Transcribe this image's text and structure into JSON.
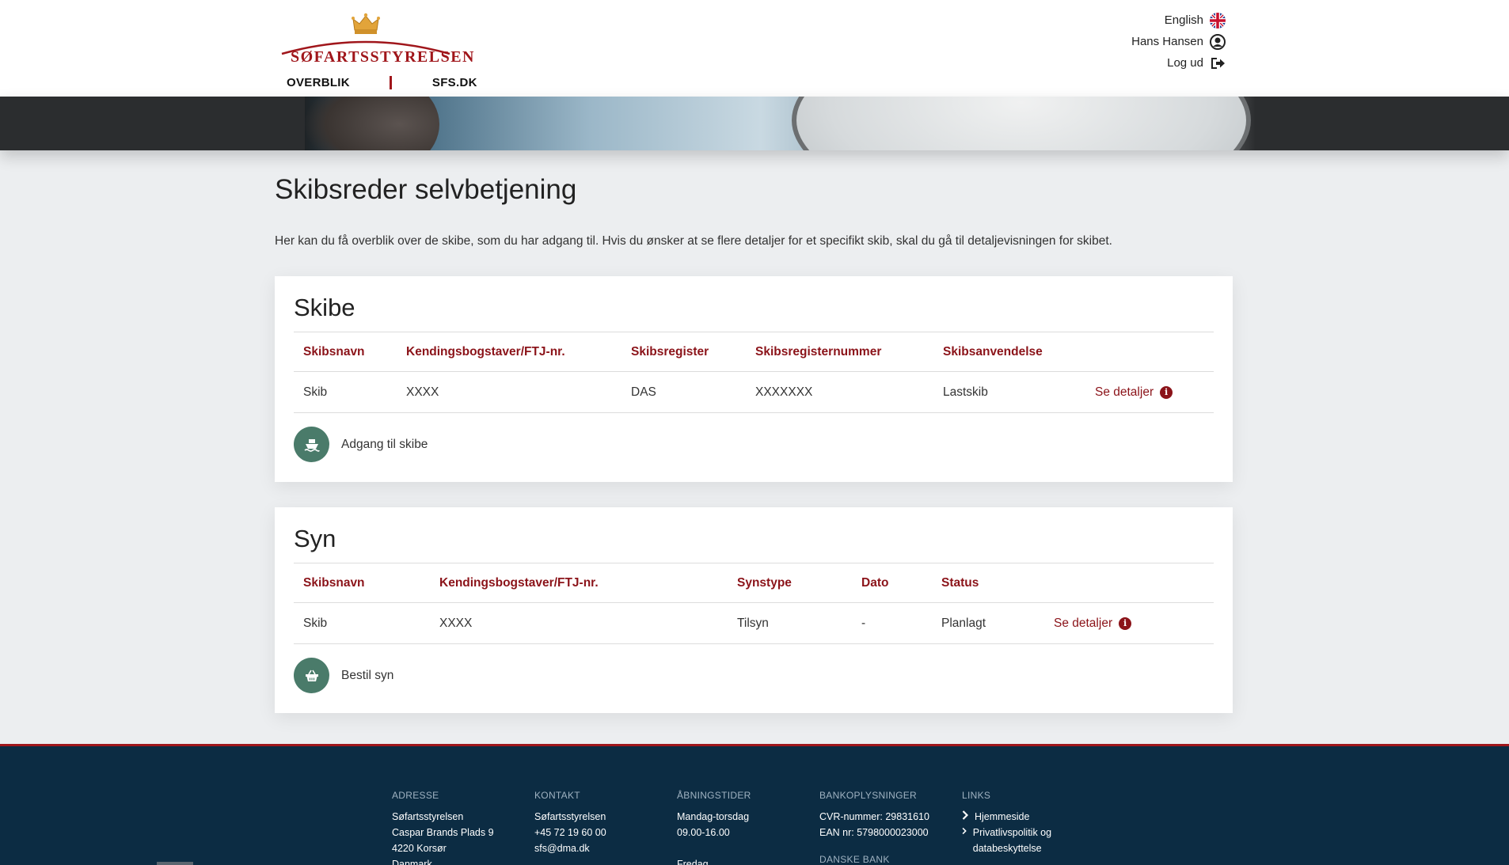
{
  "header": {
    "logo_text": "SØFARTSSTYRELSEN",
    "nav": {
      "overblik": "OVERBLIK",
      "sfs": "SFS.DK"
    },
    "user_menu": {
      "language": "English",
      "user_name": "Hans Hansen",
      "logout": "Log ud"
    }
  },
  "page": {
    "title": "Skibsreder selvbetjening",
    "intro": "Her kan du få overblik over de skibe, som du har adgang til. Hvis du ønsker at se flere detaljer for et specifikt skib, skal du gå til detaljevisningen for skibet."
  },
  "ships": {
    "title": "Skibe",
    "columns": [
      "Skibsnavn",
      "Kendingsbogstaver/FTJ-nr.",
      "Skibsregister",
      "Skibsregisternummer",
      "Skibsanvendelse"
    ],
    "rows": [
      {
        "name": "Skib",
        "callsign": "XXXX",
        "register": "DAS",
        "register_no": "XXXXXXX",
        "usage": "Lastskib",
        "details": "Se detaljer"
      }
    ],
    "action_label": "Adgang til skibe"
  },
  "inspections": {
    "title": "Syn",
    "columns": [
      "Skibsnavn",
      "Kendingsbogstaver/FTJ-nr.",
      "Synstype",
      "Dato",
      "Status"
    ],
    "rows": [
      {
        "name": "Skib",
        "callsign": "XXXX",
        "type": "Tilsyn",
        "date": "-",
        "status": "Planlagt",
        "details": "Se detaljer"
      }
    ],
    "action_label": "Bestil syn"
  },
  "footer": {
    "address": {
      "heading": "ADRESSE",
      "lines": [
        "Søfartsstyrelsen",
        "Caspar Brands Plads 9",
        "4220 Korsør",
        "Danmark"
      ]
    },
    "contact": {
      "heading": "KONTAKT",
      "lines": [
        "Søfartsstyrelsen",
        "+45 72 19 60 00",
        "sfs@dma.dk"
      ]
    },
    "hours": {
      "heading": "ÅBNINGSTIDER",
      "lines": [
        "Mandag-torsdag",
        "09.00-16.00",
        "",
        "Fredag"
      ]
    },
    "bank": {
      "heading": "BANKOPLYSNINGER",
      "lines": [
        "CVR-nummer: 29831610",
        "EAN nr: 5798000023000"
      ],
      "subheading": "DANSKE BANK"
    },
    "links": {
      "heading": "LINKS",
      "items": [
        "Hjemmeside",
        "Privatlivspolitik og databeskyttelse"
      ]
    }
  },
  "colors": {
    "brand_red": "#8b1319",
    "action_green": "#4a7b6a",
    "footer_navy": "#0c2c43"
  }
}
